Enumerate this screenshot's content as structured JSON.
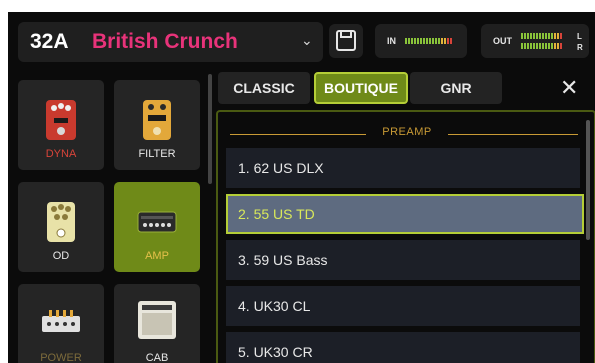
{
  "header": {
    "preset_number": "32A",
    "preset_name": "British Crunch",
    "in_label": "IN",
    "out_label": "OUT",
    "left_channel": "L",
    "right_channel": "R"
  },
  "modules": [
    {
      "label": "DYNA",
      "state": "muted-red",
      "icon": "dyna-pedal-icon"
    },
    {
      "label": "FILTER",
      "state": "normal",
      "icon": "filter-pedal-icon"
    },
    {
      "label": "OD",
      "state": "normal",
      "icon": "od-pedal-icon"
    },
    {
      "label": "AMP",
      "state": "active",
      "icon": "amp-head-icon"
    },
    {
      "label": "POWER",
      "state": "dim",
      "icon": "power-amp-icon"
    },
    {
      "label": "CAB",
      "state": "normal",
      "icon": "cab-speaker-icon"
    }
  ],
  "tabs": [
    {
      "label": "CLASSIC",
      "active": false
    },
    {
      "label": "BOUTIQUE",
      "active": true
    },
    {
      "label": "GNR",
      "active": false
    }
  ],
  "list": {
    "section": "PREAMP",
    "items": [
      "1. 62 US DLX",
      "2. 55 US TD",
      "3. 59 US Bass",
      "4. UK30 CL",
      "5. UK30 CR"
    ],
    "selected_index": 1
  },
  "colors": {
    "preset_name": "#e8337a",
    "accent_green": "#6f8a18",
    "highlight_border": "#b5ce37",
    "section_gold": "#c89a35"
  }
}
